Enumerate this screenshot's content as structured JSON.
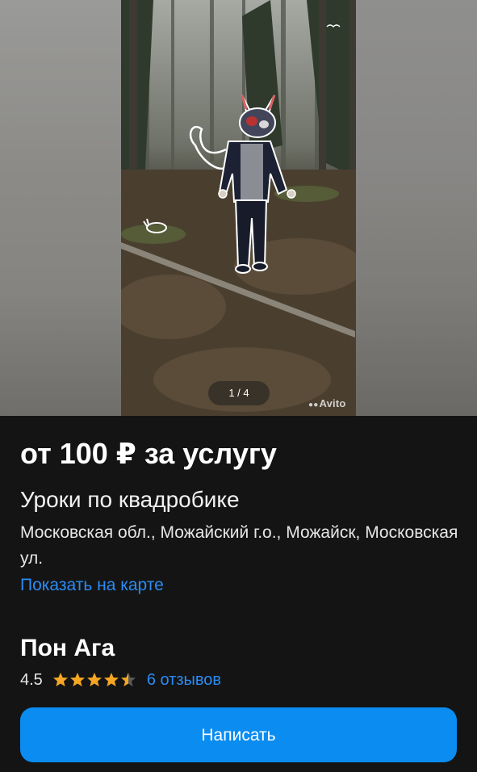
{
  "gallery": {
    "counter": "1 / 4",
    "watermark": "Avito"
  },
  "listing": {
    "price": "от 100 ₽ за услугу",
    "title": "Уроки по квадробике",
    "address": "Московская обл., Можайский г.о., Можайск, Московская ул.",
    "map_link": "Показать на карте"
  },
  "seller": {
    "name": "Пон Ага",
    "rating": "4.5",
    "rating_value": 4.5,
    "rating_max": 5,
    "reviews": "6 отзывов"
  },
  "actions": {
    "write_label": "Написать"
  },
  "colors": {
    "background": "#141414",
    "link": "#2a8cf5",
    "button": "#0a8cf0",
    "star": "#f5a623",
    "star_empty": "#5a5a5a"
  },
  "icons": {
    "star": "star-icon",
    "watermark_logo": "avito-logo"
  }
}
